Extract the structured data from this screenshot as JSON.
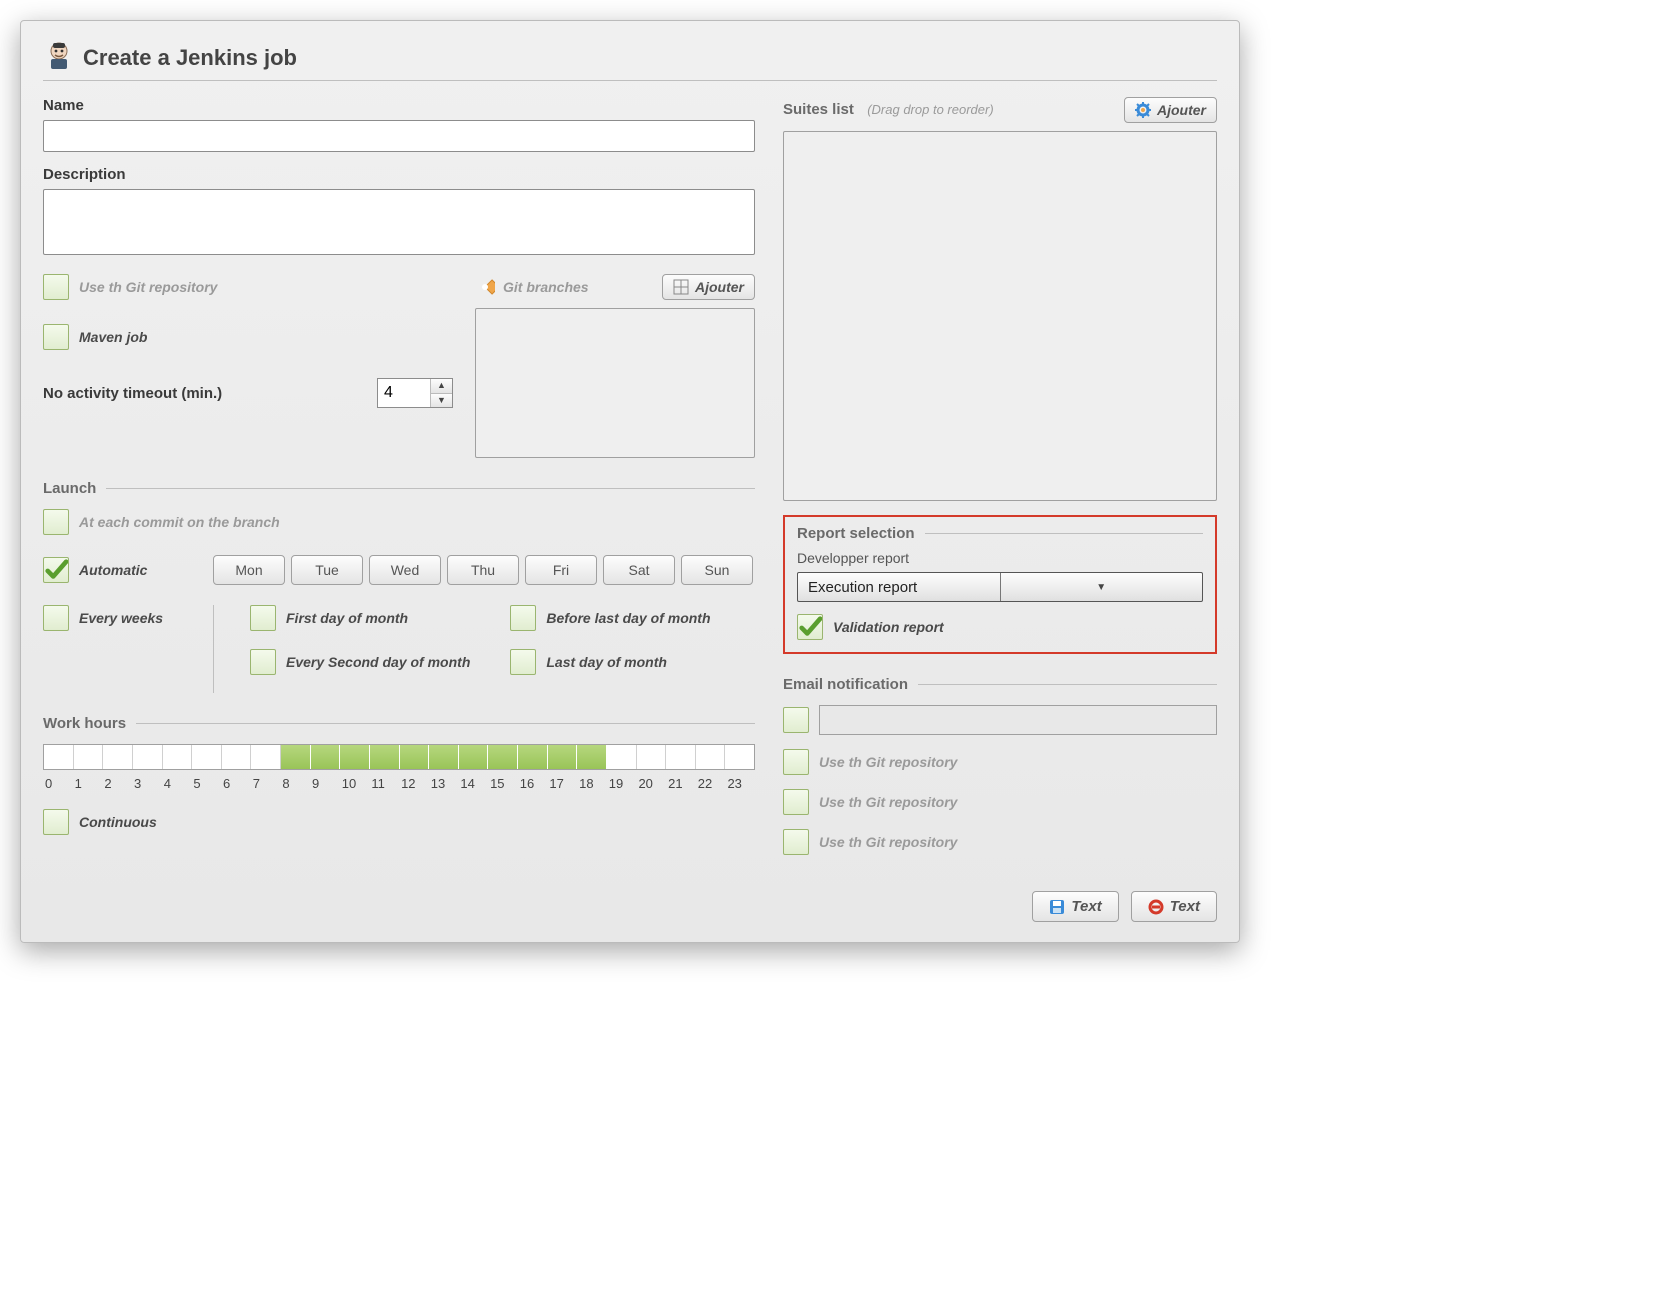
{
  "title": "Create a Jenkins job",
  "left": {
    "name_label": "Name",
    "name_value": "",
    "description_label": "Description",
    "description_value": "",
    "use_git_label": "Use th Git repository",
    "maven_label": "Maven job",
    "git_branches_label": "Git branches",
    "git_add_btn": "Ajouter",
    "timeout_label": "No activity timeout (min.)",
    "timeout_value": "4",
    "launch_label": "Launch",
    "at_each_commit_label": "At each commit on the branch",
    "automatic_label": "Automatic",
    "days": [
      "Mon",
      "Tue",
      "Wed",
      "Thu",
      "Fri",
      "Sat",
      "Sun"
    ],
    "every_weeks_label": "Every weeks",
    "month_opts": {
      "first_day": "First day of month",
      "every_second": "Every Second day of month",
      "before_last": "Before last day of month",
      "last_day": "Last day of month"
    },
    "work_hours_label": "Work hours",
    "hours": [
      "0",
      "1",
      "2",
      "3",
      "4",
      "5",
      "6",
      "7",
      "8",
      "9",
      "10",
      "11",
      "12",
      "13",
      "14",
      "15",
      "16",
      "17",
      "18",
      "19",
      "20",
      "21",
      "22",
      "23"
    ],
    "hours_on": [
      false,
      false,
      false,
      false,
      false,
      false,
      false,
      false,
      true,
      true,
      true,
      true,
      true,
      true,
      true,
      true,
      true,
      true,
      true,
      false,
      false,
      false,
      false,
      false
    ],
    "continuous_label": "Continuous"
  },
  "right": {
    "suites_label": "Suites list",
    "suites_hint": "(Drag drop to reorder)",
    "suites_add_btn": "Ajouter",
    "report_section": "Report selection",
    "dev_report_label": "Developper report",
    "dev_report_value": "Execution report",
    "validation_label": "Validation report",
    "email_section": "Email notification",
    "email_value": "",
    "email_opts": [
      "Use th Git repository",
      "Use th Git repository",
      "Use th Git repository"
    ]
  },
  "footer": {
    "btn1": "Text",
    "btn2": "Text"
  }
}
